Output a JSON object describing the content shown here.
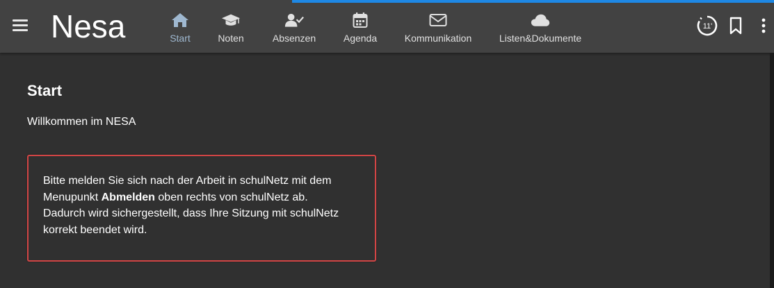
{
  "header": {
    "brand": "Nesa",
    "nav": [
      {
        "label": "Start",
        "icon": "home-icon",
        "active": true
      },
      {
        "label": "Noten",
        "icon": "graduation-cap-icon"
      },
      {
        "label": "Absenzen",
        "icon": "user-check-icon"
      },
      {
        "label": "Agenda",
        "icon": "calendar-icon"
      },
      {
        "label": "Kommunikation",
        "icon": "envelope-icon"
      },
      {
        "label": "Listen&Dokumente",
        "icon": "cloud-icon"
      }
    ],
    "timer_label": "11'",
    "right_icons": [
      "session-timer-icon",
      "bookmark-icon",
      "more-vertical-icon"
    ]
  },
  "main": {
    "title": "Start",
    "welcome": "Willkommen im NESA",
    "notice": {
      "line1_pre": "Bitte melden Sie sich nach der Arbeit in schulNetz mit dem Menupunkt ",
      "line1_bold": "Abmelden",
      "line1_post": " oben rechts von schulNetz ab.",
      "line2": "Dadurch wird sichergestellt, dass Ihre Sitzung mit schulNetz korrekt beendet wird."
    }
  },
  "colors": {
    "background": "#303030",
    "topbar": "#424242",
    "accent": "#1e88e5",
    "notice_border": "#d24545",
    "active_nav": "#9fb8d0"
  }
}
